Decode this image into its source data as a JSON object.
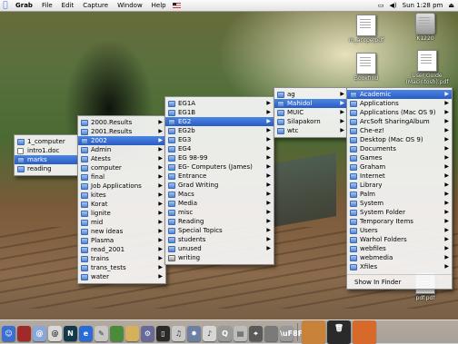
{
  "menubar": {
    "apple_glyph": "",
    "app_name": "Grab",
    "items": [
      "File",
      "Edit",
      "Capture",
      "Window",
      "Help"
    ],
    "clock": "Sun 1:28 pm"
  },
  "desktop_icons": [
    {
      "label": "m_accpe.pdf"
    },
    {
      "label": "K1220"
    },
    {
      "label": "Bookfind"
    },
    {
      "label": "User Guide (Macintosh).pdf"
    },
    {
      "label": "pdf.pdf"
    }
  ],
  "menus": {
    "m1": [
      "1_computer",
      "intro1.doc",
      "marks",
      "reading"
    ],
    "m2": [
      "2000.Results",
      "2001.Results",
      "2002",
      "Admin",
      "Atests",
      "computer",
      "final",
      "Job Applications",
      "kites",
      "Korat",
      "lignite",
      "mid",
      "new ideas",
      "Plasma",
      "read_2001",
      "trains",
      "trans_tests",
      "water"
    ],
    "m3": [
      "EG1A",
      "EG1B",
      "EG2",
      "EG2b",
      "EG3",
      "EG4",
      "EG 98-99",
      "EG- Computers (James)",
      "Entrance",
      "Grad Writing",
      "Macs",
      "Media",
      "misc",
      "Reading",
      "Special Topics",
      "students",
      "unused",
      "writing"
    ],
    "m4": [
      "ag",
      "Mahidol",
      "MUIC",
      "Silapakorn",
      "wtc"
    ],
    "m5": [
      "Academic",
      "Applications",
      "Applications (Mac OS 9)",
      "ArcSoft SharingAlbum",
      "Che-ez!",
      "Desktop (Mac OS 9)",
      "Documents",
      "Games",
      "Graham",
      "Internet",
      "Library",
      "Palm",
      "System",
      "System Folder",
      "Temporary Items",
      "Users",
      "Warhol Folders",
      "webfiles",
      "webmedia",
      "Xfiles"
    ],
    "m5_footer": "Show In Finder"
  },
  "colors": {
    "selection": "#3a6fd6",
    "menubar": "#ececec"
  }
}
